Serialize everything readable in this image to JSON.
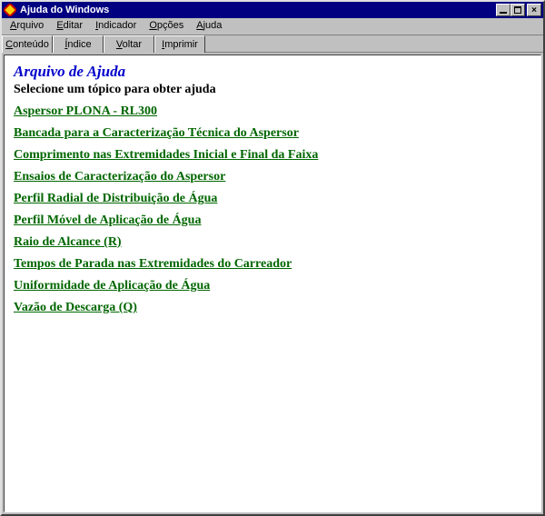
{
  "window": {
    "title": "Ajuda do Windows"
  },
  "menubar": {
    "items": [
      {
        "hotkey": "A",
        "rest": "rquivo"
      },
      {
        "hotkey": "E",
        "rest": "ditar"
      },
      {
        "hotkey": "I",
        "rest": "ndicador"
      },
      {
        "hotkey": "O",
        "rest": "pções"
      },
      {
        "hotkey": "A",
        "rest": "juda"
      }
    ]
  },
  "toolbar": {
    "buttons": [
      {
        "hotkey": "C",
        "rest": "onteúdo"
      },
      {
        "hotkey": "Í",
        "rest": "ndice"
      },
      {
        "hotkey": "V",
        "rest": "oltar"
      },
      {
        "hotkey": "I",
        "rest": "mprimir"
      }
    ]
  },
  "help": {
    "title": "Arquivo de Ajuda",
    "subtitle": "Selecione um tópico para obter ajuda",
    "topics": [
      "Aspersor PLONA - RL300",
      "Bancada para a Caracterização Técnica do Aspersor",
      "Comprimento nas Extremidades Inicial e Final da Faixa",
      "Ensaios de Caracterização do Aspersor",
      "Perfil Radial de Distribuição de Água",
      "Perfil Móvel de Aplicação de Água",
      "Raio de Alcance (R)",
      "Tempos de Parada nas Extremidades do Carreador",
      "Uniformidade de Aplicação de Água",
      "Vazão de Descarga (Q)"
    ]
  }
}
